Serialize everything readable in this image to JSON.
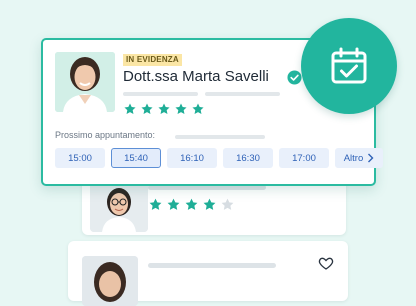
{
  "featured": {
    "badge": "IN EVIDENZA",
    "doctor_name": "Dott.ssa Marta Savelli",
    "rating_stars": 5,
    "next_appointment_label": "Prossimo appuntamento:",
    "slots": [
      "15:00",
      "15:40",
      "16:10",
      "16:30",
      "17:00"
    ],
    "selected_slot": "15:40",
    "more_label": "Altro"
  },
  "second_card": {
    "rating_stars": 4
  },
  "colors": {
    "accent": "#22b59e",
    "star": "#1fae97",
    "star_empty": "#d7dde2",
    "slot_text": "#2f62b7",
    "badge_bg": "#fbe6a5"
  },
  "icons": [
    "verified-check-icon",
    "calendar-check-icon",
    "heart-icon",
    "chevron-right-icon",
    "star-icon"
  ]
}
